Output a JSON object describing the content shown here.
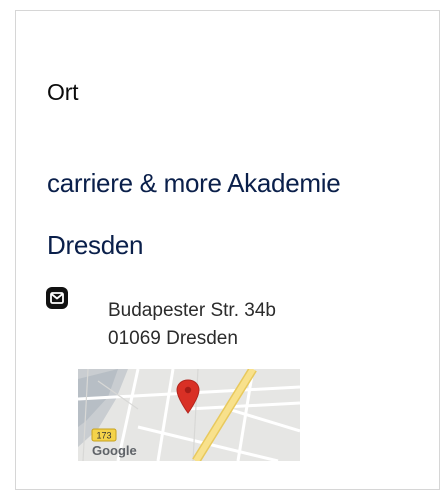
{
  "location": {
    "heading": "Ort",
    "organization": "carriere & more Akademie",
    "city": "Dresden",
    "address_line1": "Budapester Str. 34b",
    "address_line2": "01069 Dresden",
    "contact_icon": "mail-icon"
  },
  "map": {
    "road_shield": "173",
    "logo_text": "Google",
    "marker_icon": "map-pin-icon",
    "colors": {
      "background": "#e5e5e3",
      "road_major": "#f7e08e",
      "marker": "#d93025",
      "water": "#aab3bb"
    }
  }
}
